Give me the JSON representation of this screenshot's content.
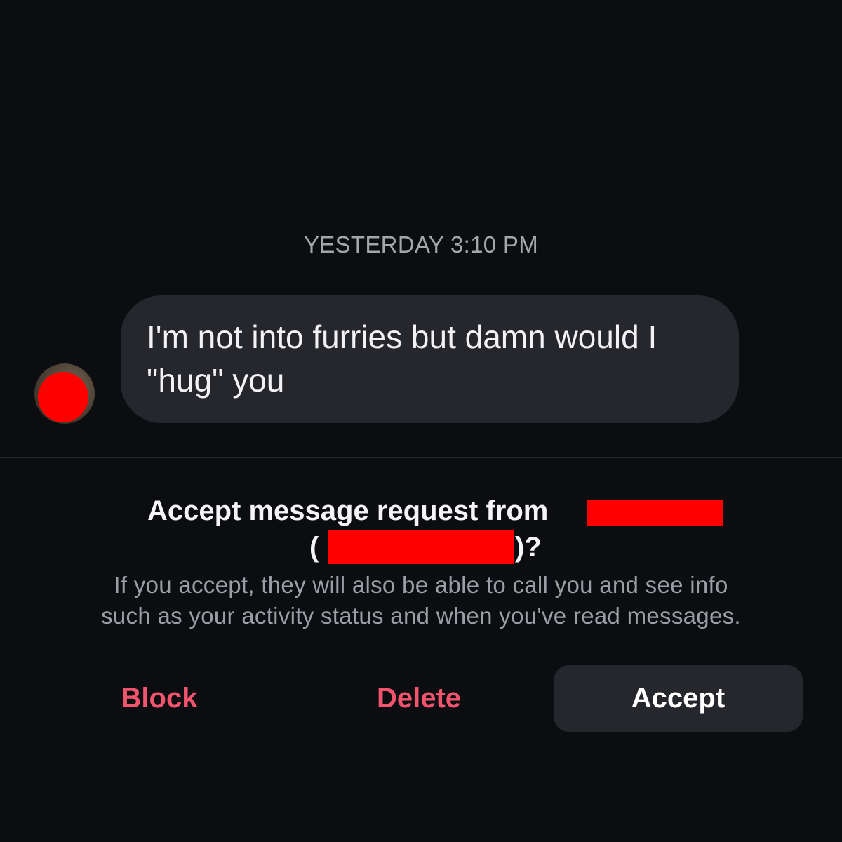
{
  "thread": {
    "timestamp": "YESTERDAY 3:10 PM",
    "messages": [
      {
        "text": "I'm not into furries but damn would I \"hug\" you",
        "line1": "I'm not into furries but damn would I",
        "line2": "\"hug\" you"
      }
    ]
  },
  "request": {
    "title_prefix": "Accept message request from",
    "paren_open": "(",
    "paren_close": ")?",
    "body_line1": "If you accept, they will also be able to call you and see info",
    "body_line2": "such as your activity status and when you've read messages."
  },
  "actions": {
    "block_label": "Block",
    "delete_label": "Delete",
    "accept_label": "Accept"
  },
  "colors": {
    "background": "#0b0d11",
    "bubble": "#25272d",
    "destructive": "#f2546d",
    "redaction": "#ff0000"
  }
}
